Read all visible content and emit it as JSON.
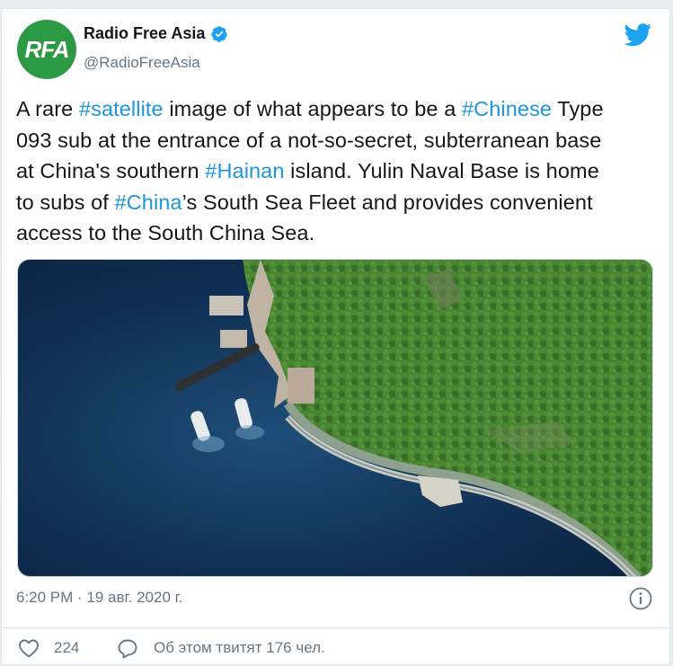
{
  "author": {
    "display_name": "Radio Free Asia",
    "handle": "@RadioFreeAsia",
    "avatar_text": "RFA",
    "avatar_color": "#2c9a45",
    "verified": true
  },
  "tweet": {
    "lines": [
      [
        {
          "t": "A rare ",
          "tag": false
        },
        {
          "t": "#satellite",
          "tag": true
        },
        {
          "t": " image of what appears to be a ",
          "tag": false
        },
        {
          "t": "#Chinese",
          "tag": true
        },
        {
          "t": " Type",
          "tag": false
        }
      ],
      [
        {
          "t": "093 sub at the entrance of a not-so-secret, subterranean base",
          "tag": false
        }
      ],
      [
        {
          "t": "at China's southern ",
          "tag": false
        },
        {
          "t": "#Hainan",
          "tag": true
        },
        {
          "t": " island. Yulin Naval Base is home",
          "tag": false
        }
      ],
      [
        {
          "t": "to subs of ",
          "tag": false
        },
        {
          "t": "#China",
          "tag": true
        },
        {
          "t": "’s South Sea Fleet and provides convenient",
          "tag": false
        }
      ],
      [
        {
          "t": "access to the South China Sea.",
          "tag": false
        }
      ]
    ],
    "hashtag_color": "#1b95e0"
  },
  "meta": {
    "timestamp": "6:20 PM · 19 авг. 2020 г.",
    "like_count": "224",
    "retweet_text": "Об этом твитят 176 чел."
  },
  "icons": {
    "brand": "twitter-bird-icon",
    "info": "info-icon",
    "like": "heart-icon",
    "reply": "speech-bubble-icon"
  }
}
